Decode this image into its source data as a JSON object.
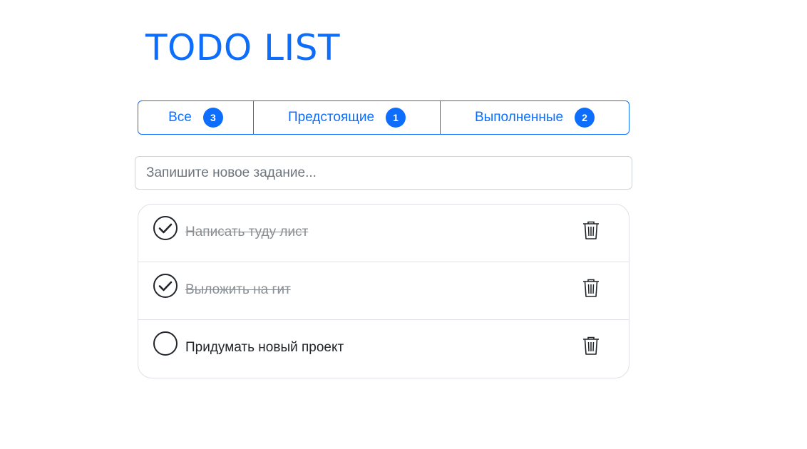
{
  "header": {
    "title": "TODO LIST"
  },
  "tabs": [
    {
      "label": "Все",
      "count": "3"
    },
    {
      "label": "Предстоящие",
      "count": "1"
    },
    {
      "label": "Выполненные",
      "count": "2"
    }
  ],
  "new_task": {
    "placeholder": "Запишите новое задание...",
    "value": ""
  },
  "tasks": [
    {
      "text": "Написать туду лист",
      "done": true,
      "check_icon": "check-circle-icon",
      "delete_icon": "trash-icon"
    },
    {
      "text": "Выложить на гит",
      "done": true,
      "check_icon": "check-circle-icon",
      "delete_icon": "trash-icon"
    },
    {
      "text": "Придумать новый проект",
      "done": false,
      "check_icon": "empty-circle-icon",
      "delete_icon": "trash-icon"
    }
  ],
  "colors": {
    "accent": "#0d6efd",
    "done_text": "#8a8f94",
    "border": "#dee2e6"
  }
}
